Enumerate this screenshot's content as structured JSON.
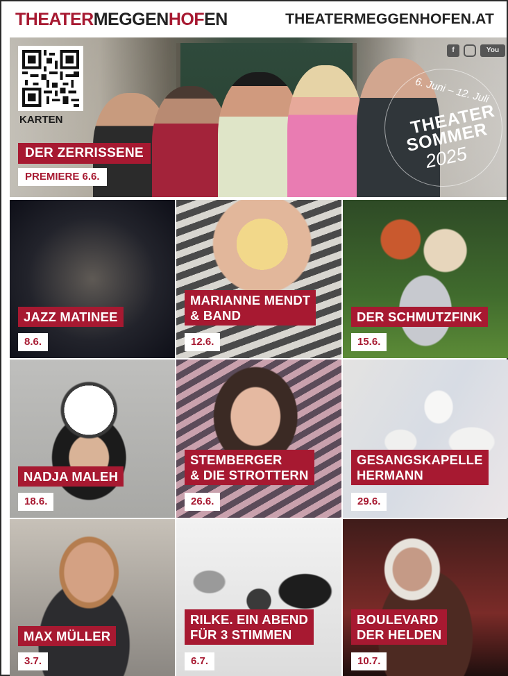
{
  "header": {
    "logo": [
      {
        "text": "THEATER",
        "color": "#a71931"
      },
      {
        "text": "MEGGEN",
        "color": "#222222"
      },
      {
        "text": "HOF",
        "color": "#a71931"
      },
      {
        "text": "EN",
        "color": "#222222"
      }
    ],
    "url": "THEATERMEGGENHOFEN.AT"
  },
  "hero": {
    "qr_label": "KARTEN",
    "social": {
      "facebook": "f",
      "youtube": "You"
    },
    "badge": {
      "dates": "6. Juni – 12. Juli",
      "line1": "THEATER",
      "line2": "SOMMER",
      "line3": "2025"
    },
    "title": "DER ZERRISSENE",
    "subtitle": "PREMIERE 6.6."
  },
  "events": [
    {
      "title_lines": [
        "JAZZ MATINEE"
      ],
      "date": "8.6."
    },
    {
      "title_lines": [
        "MARIANNE MENDT",
        "& BAND"
      ],
      "date": "12.6."
    },
    {
      "title_lines": [
        "DER SCHMUTZFINK"
      ],
      "date": "15.6."
    },
    {
      "title_lines": [
        "NADJA MALEH"
      ],
      "date": "18.6."
    },
    {
      "title_lines": [
        "STEMBERGER",
        "& DIE STROTTERN"
      ],
      "date": "26.6."
    },
    {
      "title_lines": [
        "GESANGSKAPELLE",
        "HERMANN"
      ],
      "date": "29.6."
    },
    {
      "title_lines": [
        "MAX MÜLLER"
      ],
      "date": "3.7."
    },
    {
      "title_lines": [
        "RILKE. EIN ABEND",
        "FÜR 3 STIMMEN"
      ],
      "date": "6.7."
    },
    {
      "title_lines": [
        "BOULEVARD",
        "DER HELDEN"
      ],
      "date": "10.7."
    }
  ],
  "colors": {
    "brand": "#a71931",
    "dark": "#222222"
  }
}
